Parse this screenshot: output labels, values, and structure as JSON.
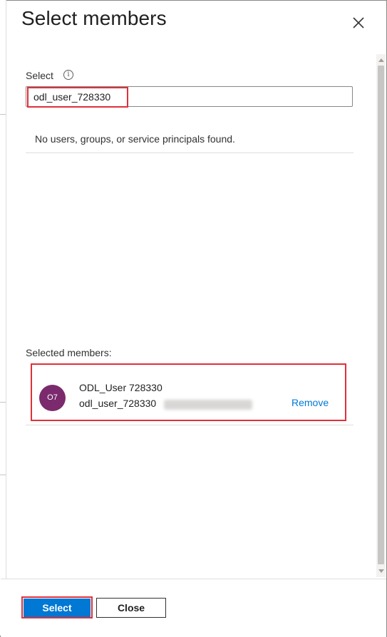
{
  "panel": {
    "title": "Select members"
  },
  "search": {
    "label": "Select",
    "info_icon_glyph": "i",
    "value": "odl_user_728330",
    "placeholder": "",
    "no_results_text": "No users, groups, or service principals found."
  },
  "selected": {
    "label": "Selected members:",
    "members": [
      {
        "avatar_initials": "O7",
        "avatar_color": "#7b2a6e",
        "display_name": "ODL_User 728330",
        "upn_prefix": "odl_user_728330",
        "remove_label": "Remove"
      }
    ]
  },
  "footer": {
    "select_label": "Select",
    "close_label": "Close"
  },
  "colors": {
    "accent": "#0078d4",
    "highlight": "#e0303a",
    "link": "#0078d4"
  },
  "icons": {
    "close": "close-icon",
    "info": "info-icon",
    "scroll_up": "chevron-up-icon",
    "scroll_down": "chevron-down-icon"
  }
}
